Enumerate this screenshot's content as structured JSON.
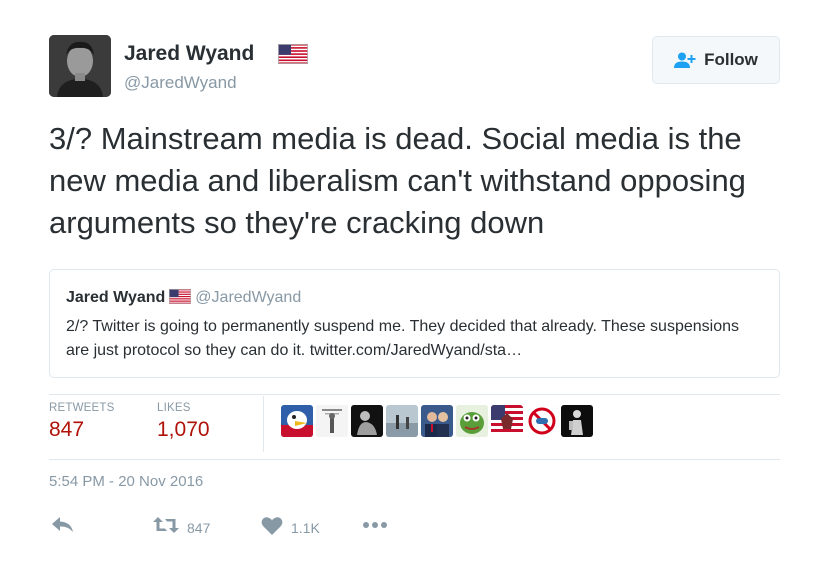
{
  "colors": {
    "text": "#292f33",
    "muted": "#8899a6",
    "stat_value": "#b0120a",
    "border": "#e1e8ed",
    "follow_icon": "#1da1f2"
  },
  "author": {
    "name": "Jared Wyand",
    "handle": "@JaredWyand",
    "flag_icon": "us-flag-icon"
  },
  "follow_button": {
    "label": "Follow",
    "icon": "add-user-icon"
  },
  "tweet": {
    "text": "3/? Mainstream media is dead. Social media is the new media and liberalism can't withstand opposing arguments so they're cracking down"
  },
  "quoted_tweet": {
    "name": "Jared Wyand",
    "handle": "@JaredWyand",
    "text": "2/? Twitter is going to permanently suspend me. They decided that already. These suspensions are just protocol so they can do it. twitter.com/JaredWyand/sta…"
  },
  "stats": {
    "retweets_label": "RETWEETS",
    "retweets_value": "847",
    "likes_label": "LIKES",
    "likes_value": "1,070"
  },
  "timestamp": "5:54 PM - 20 Nov 2016",
  "actions": {
    "reply_icon": "reply-icon",
    "retweet_icon": "retweet-icon",
    "retweet_count": "847",
    "like_icon": "heart-icon",
    "like_count": "1.1K",
    "more_icon": "more-icon"
  }
}
